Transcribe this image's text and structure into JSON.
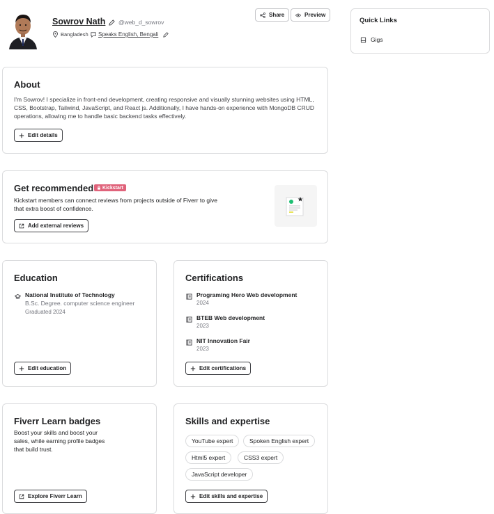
{
  "profile": {
    "name": "Sowrov Nath",
    "username": "@web_d_sowrov",
    "country": "Bangladesh",
    "languages": "Speaks English, Bengali"
  },
  "header_actions": {
    "share_label": "Share",
    "preview_label": "Preview"
  },
  "quick_links": {
    "title": "Quick Links",
    "items": [
      {
        "label": "Gigs"
      }
    ]
  },
  "about": {
    "title": "About",
    "text": "I'm Sowrov! I specialize in front-end development, creating responsive and visually stunning websites using HTML, CSS, Bootstrap, Tailwind, JavaScript, and React js. Additionally, I have hands-on experience with MongoDB CRUD operations, allowing me to handle basic backend tasks effectively.",
    "edit_label": "Edit details"
  },
  "recommended": {
    "title": "Get recommended",
    "badge": "Kickstart",
    "text": "Kickstart members can connect reviews from projects outside of Fiverr to give that extra boost of confidence.",
    "button_label": "Add external reviews"
  },
  "education": {
    "title": "Education",
    "items": [
      {
        "school": "National Institute of Technology",
        "degree": "B.Sc. Degree. computer science engineer",
        "graduated": "Graduated 2024"
      }
    ],
    "edit_label": "Edit education"
  },
  "certifications": {
    "title": "Certifications",
    "items": [
      {
        "name": "Programing Hero Web development",
        "year": "2024"
      },
      {
        "name": "BTEB Web development",
        "year": "2023"
      },
      {
        "name": "NIT Innovation Fair",
        "year": "2023"
      }
    ],
    "edit_label": "Edit certifications"
  },
  "badges": {
    "title": "Fiverr Learn badges",
    "text": "Boost your skills and boost your sales, while earning profile badges that build trust.",
    "button_label": "Explore Fiverr Learn"
  },
  "skills": {
    "title": "Skills and expertise",
    "items": [
      "YouTube expert",
      "Spoken English expert",
      "Html5 expert",
      "CSS3 expert",
      "JavaScript developer"
    ],
    "edit_label": "Edit skills and expertise"
  },
  "colors": {
    "badge_bg": "#e0637b",
    "accent_green": "#1dbf73"
  }
}
